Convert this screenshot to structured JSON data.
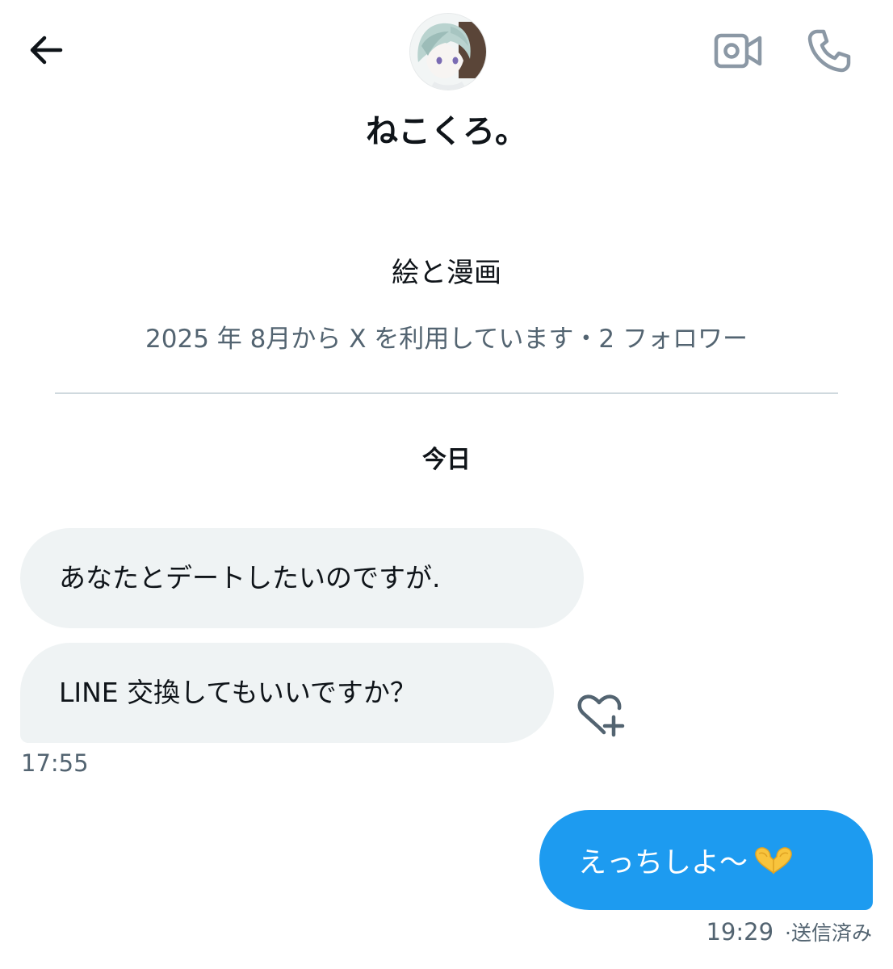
{
  "header": {
    "back_icon": "arrow-left-icon",
    "video_icon": "video-camera-icon",
    "call_icon": "phone-icon",
    "avatar": "user-avatar"
  },
  "profile": {
    "display_name": "ねこくろ。",
    "bio": "絵と漫画",
    "meta": "2025 年 8月から X を利用しています・2 フォロワー"
  },
  "conversation": {
    "date_separator": "今日",
    "incoming": [
      {
        "text": "あなたとデートしたいのですが."
      },
      {
        "text": "LINE 交換してもいいですか？"
      }
    ],
    "incoming_time": "17:55",
    "reaction_icon": "heart-plus-icon",
    "outgoing": [
      {
        "text": "えっちしよ〜",
        "emoji": "heart-hands-emoji"
      }
    ],
    "outgoing_time": "19:29",
    "outgoing_status": "·送信済み"
  },
  "colors": {
    "accent": "#1d9bf0",
    "incoming_bubble": "#eff3f4",
    "secondary_text": "#536471",
    "primary_text": "#0f1419",
    "divider": "#cfd9de"
  }
}
